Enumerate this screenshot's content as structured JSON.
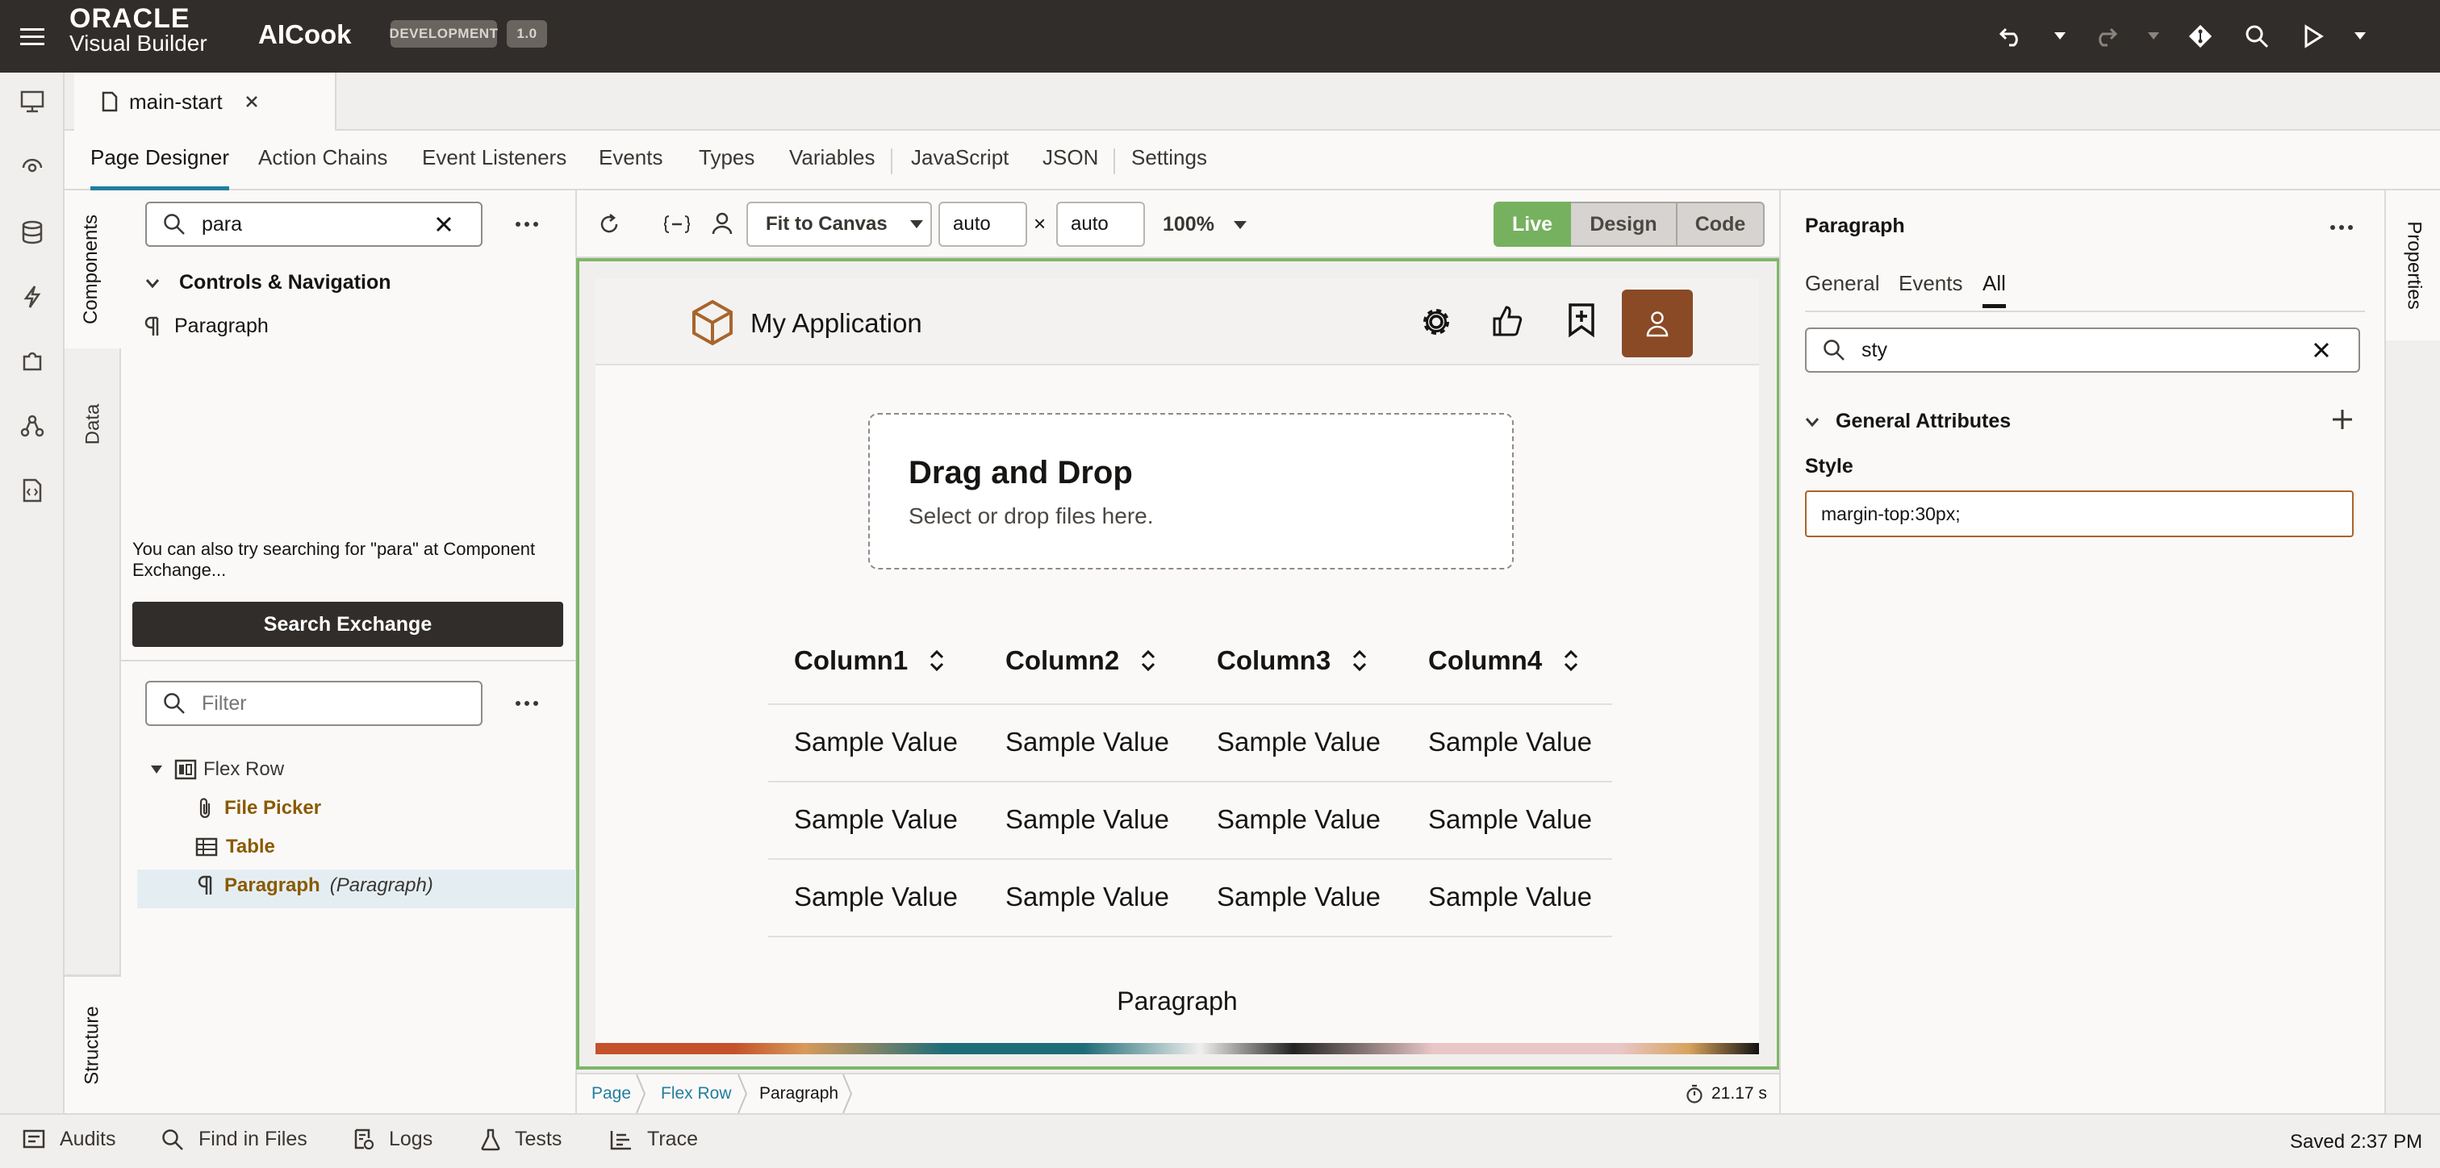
{
  "header": {
    "brand_line1": "ORACLE",
    "brand_line2": "Visual Builder",
    "app_name": "AICook",
    "env_badge": "DEVELOPMENT",
    "version_badge": "1.0",
    "icons": [
      "hamburger-icon",
      "undo-icon",
      "redo-icon",
      "git-icon",
      "search-icon",
      "run-icon"
    ]
  },
  "file_tab": {
    "label": "main-start"
  },
  "nav_tabs": [
    "Page Designer",
    "Action Chains",
    "Event Listeners",
    "Events",
    "Types",
    "Variables",
    "JavaScript",
    "JSON",
    "Settings"
  ],
  "left_vtabs": {
    "components": "Components",
    "data": "Data",
    "structure": "Structure"
  },
  "components": {
    "search_value": "para",
    "group_label": "Controls & Navigation",
    "item_label": "Paragraph",
    "hint": "You can also try searching for \"para\" at Component Exchange...",
    "exchange_button": "Search Exchange"
  },
  "structure": {
    "filter_placeholder": "Filter",
    "root": "Flex Row",
    "children": [
      {
        "label": "File Picker"
      },
      {
        "label": "Table"
      },
      {
        "label": "Paragraph",
        "detail": "(Paragraph)"
      }
    ]
  },
  "canvas_toolbar": {
    "fit": "Fit to Canvas",
    "width": "auto",
    "times": "×",
    "height": "auto",
    "zoom": "100%",
    "modes": [
      "Live",
      "Design",
      "Code"
    ],
    "active_mode": "Live"
  },
  "app": {
    "title": "My Application",
    "dropzone_title": "Drag and Drop",
    "dropzone_sub": "Select or drop files here.",
    "columns": [
      "Column1",
      "Column2",
      "Column3",
      "Column4"
    ],
    "rows": [
      [
        "Sample Value",
        "Sample Value",
        "Sample Value",
        "Sample Value"
      ],
      [
        "Sample Value",
        "Sample Value",
        "Sample Value",
        "Sample Value"
      ],
      [
        "Sample Value",
        "Sample Value",
        "Sample Value",
        "Sample Value"
      ]
    ],
    "paragraph": "Paragraph"
  },
  "breadcrumb": {
    "items": [
      "Page",
      "Flex Row",
      "Paragraph"
    ],
    "timer": "21.17 s"
  },
  "properties": {
    "title": "Paragraph",
    "tabs": [
      "General",
      "Events",
      "All"
    ],
    "active_tab": "All",
    "search_value": "sty",
    "section": "General Attributes",
    "field_label": "Style",
    "field_value": "margin-top:30px;",
    "rail_label": "Properties"
  },
  "footer": {
    "items": [
      "Audits",
      "Find in Files",
      "Logs",
      "Tests",
      "Trace"
    ],
    "status": "Saved 2:37 PM"
  },
  "colors": {
    "header_bg": "#312d2a",
    "live_green": "#76b15f",
    "accent_link": "#227e9e",
    "tree_gold": "#8a5a00"
  }
}
